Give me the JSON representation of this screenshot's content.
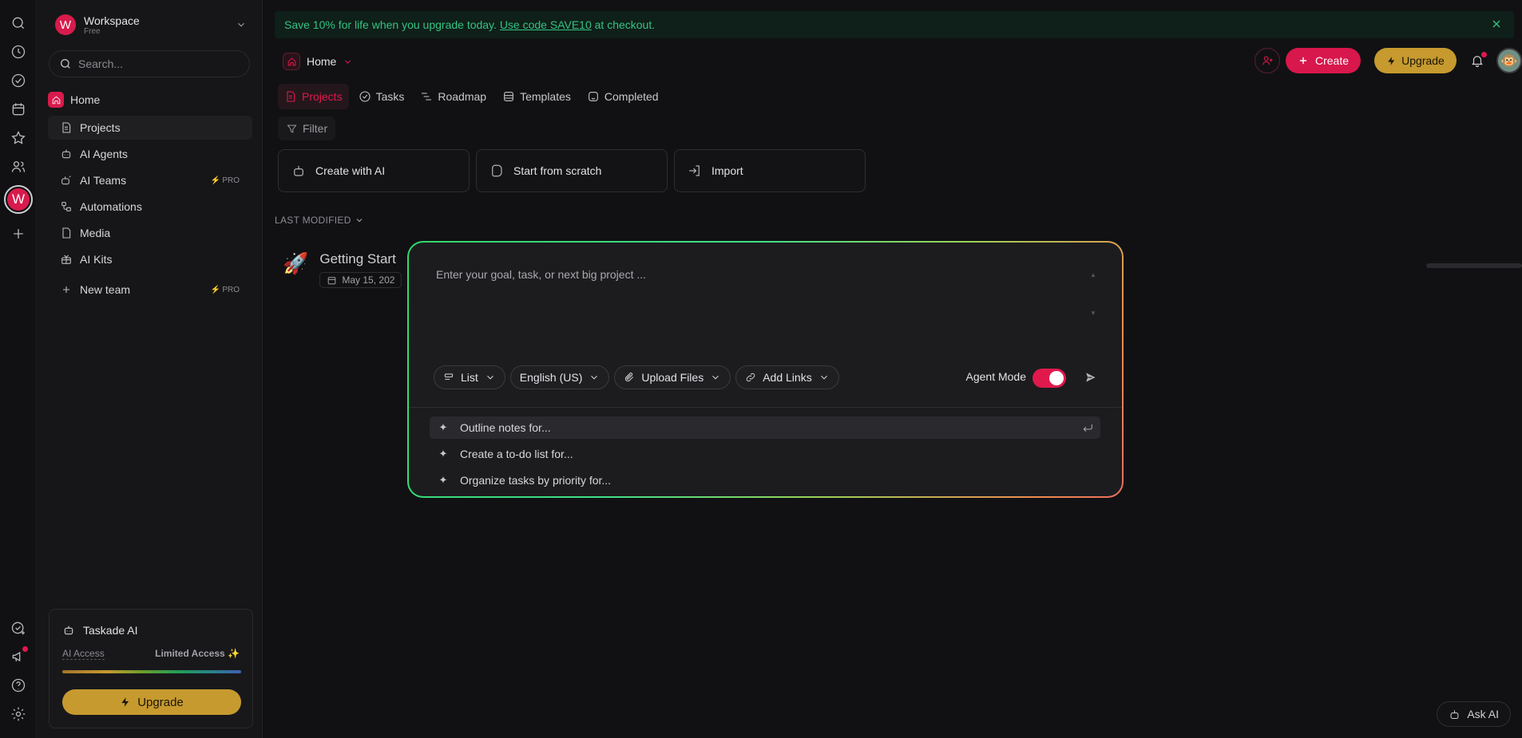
{
  "promo": {
    "text_before": "Save 10% for life when you upgrade today.",
    "link": "Use code SAVE10",
    "text_after": "at checkout."
  },
  "workspace": {
    "initial": "W",
    "name": "Workspace",
    "plan": "Free"
  },
  "search": {
    "placeholder": "Search..."
  },
  "sidebar": {
    "home": "Home",
    "items": [
      {
        "label": "Projects",
        "icon": "document-icon"
      },
      {
        "label": "AI Agents",
        "icon": "robot-icon"
      },
      {
        "label": "AI Teams",
        "icon": "robot-team-icon",
        "badge": "PRO"
      },
      {
        "label": "Automations",
        "icon": "automation-icon"
      },
      {
        "label": "Media",
        "icon": "media-icon"
      },
      {
        "label": "AI Kits",
        "icon": "kit-icon"
      }
    ],
    "new_team": {
      "label": "New team",
      "badge": "PRO"
    }
  },
  "ai_card": {
    "title": "Taskade AI",
    "access_label": "AI Access",
    "access_value": "Limited Access ✨",
    "upgrade": "Upgrade"
  },
  "breadcrumb": {
    "label": "Home"
  },
  "tabs": [
    {
      "label": "Projects",
      "active": true
    },
    {
      "label": "Tasks"
    },
    {
      "label": "Roadmap"
    },
    {
      "label": "Templates"
    },
    {
      "label": "Completed"
    }
  ],
  "filter": "Filter",
  "quick_actions": [
    "Create with AI",
    "Start from scratch",
    "Import"
  ],
  "sort_label": "LAST MODIFIED",
  "project": {
    "icon": "🚀",
    "title": "Getting Start",
    "date": "May 15, 202"
  },
  "header": {
    "create": "Create",
    "upgrade": "Upgrade"
  },
  "ask_ai": "Ask AI",
  "modal": {
    "placeholder": "Enter your goal, task, or next big project ...",
    "chips": [
      "List",
      "English (US)",
      "Upload Files",
      "Add Links"
    ],
    "agent_mode_label": "Agent Mode",
    "agent_mode_on": true,
    "suggestions": [
      "Outline notes for...",
      "Create a to-do list for...",
      "Organize tasks by priority for..."
    ]
  },
  "colors": {
    "accent": "#e0194d",
    "gold": "#c69a2e",
    "promo_text": "#35c283"
  }
}
